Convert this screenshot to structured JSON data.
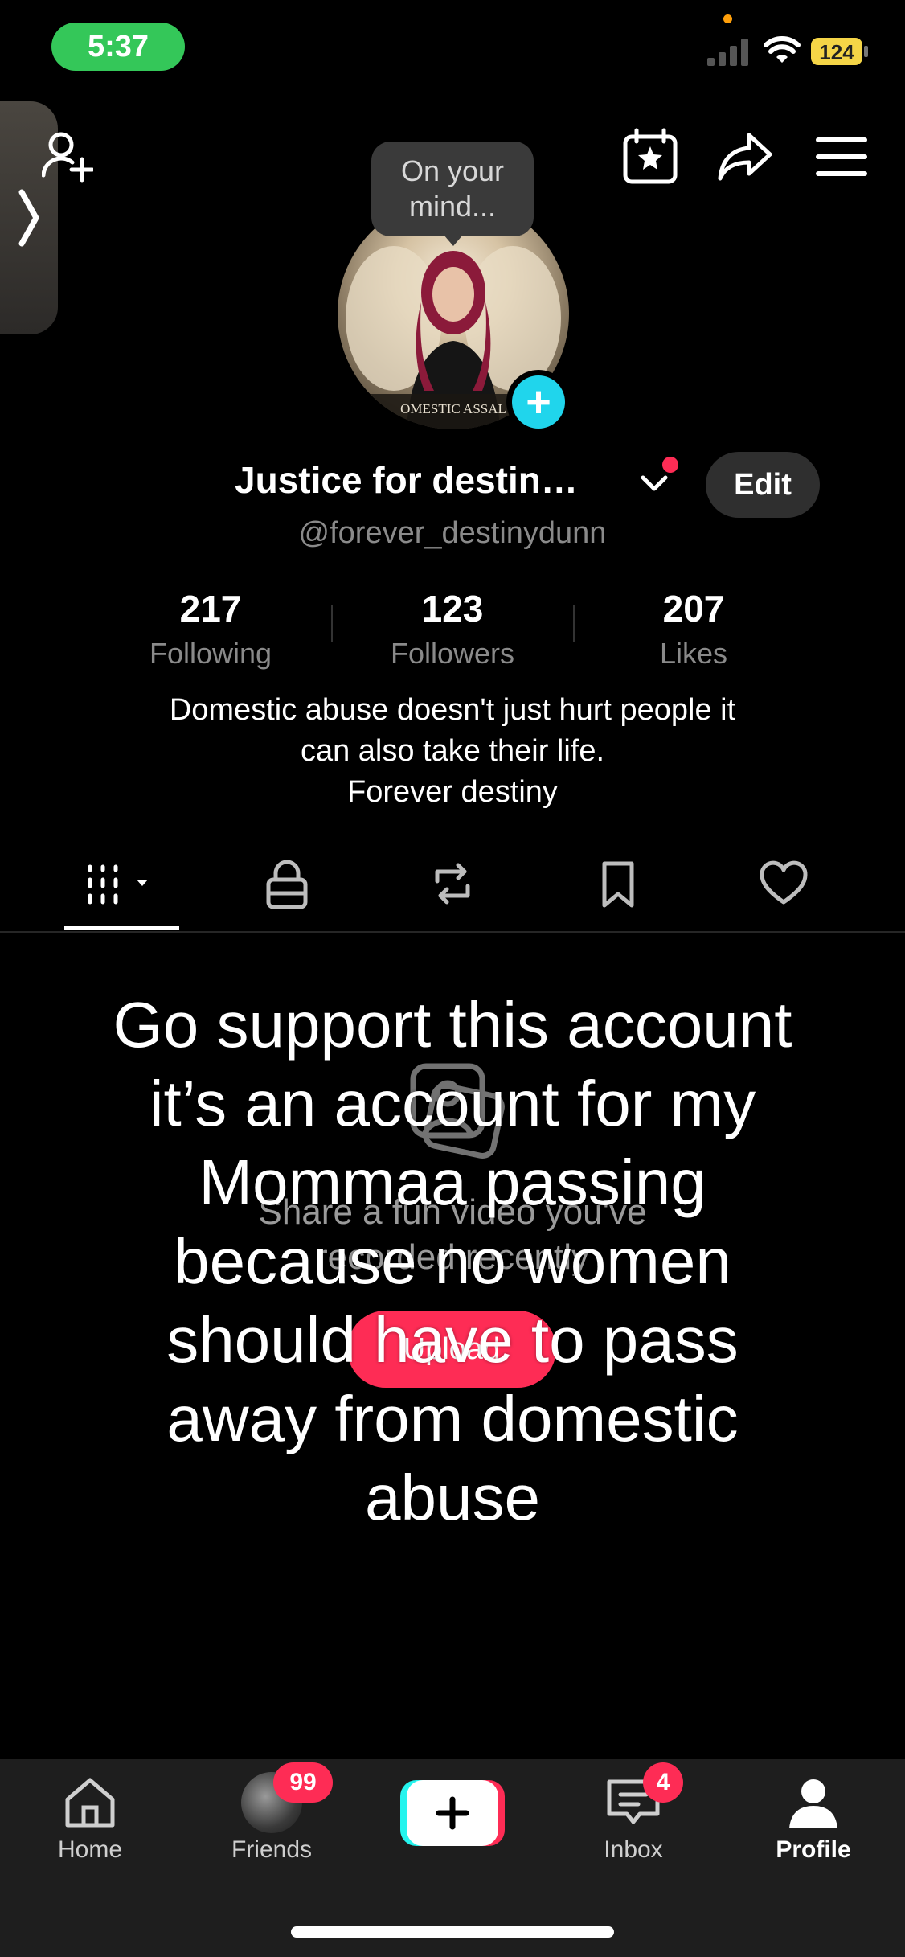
{
  "status_bar": {
    "time": "5:37",
    "battery": "124"
  },
  "tooltip": {
    "line1": "On your",
    "line2": "mind..."
  },
  "profile": {
    "display_name": "Justice for destin…",
    "handle": "@forever_destinydunn",
    "edit_label": "Edit",
    "stats": [
      {
        "value": "217",
        "label": "Following"
      },
      {
        "value": "123",
        "label": "Followers"
      },
      {
        "value": "207",
        "label": "Likes"
      }
    ],
    "bio": [
      "Domestic abuse doesn't just hurt people it",
      "can also take their life.",
      "Forever destiny"
    ],
    "avatar_caption": "OMESTIC ASSAL"
  },
  "tabs": [
    "videos-tab",
    "private-tab",
    "reposts-tab",
    "saved-tab",
    "liked-tab"
  ],
  "empty_state": {
    "line1": "Share a fun video you've",
    "line2": "recorded recently",
    "upload_label": "Upload"
  },
  "overlay_text": [
    "Go support this account",
    "it’s an account for my",
    "Mommaa passing",
    "because no women",
    "should have to pass",
    "away from domestic",
    "abuse"
  ],
  "nav": {
    "home": "Home",
    "friends": "Friends",
    "friends_badge": "99",
    "inbox": "Inbox",
    "inbox_badge": "4",
    "profile": "Profile"
  },
  "colors": {
    "accent": "#fe2c55",
    "teal": "#20d5ec",
    "status_green": "#34c759"
  }
}
